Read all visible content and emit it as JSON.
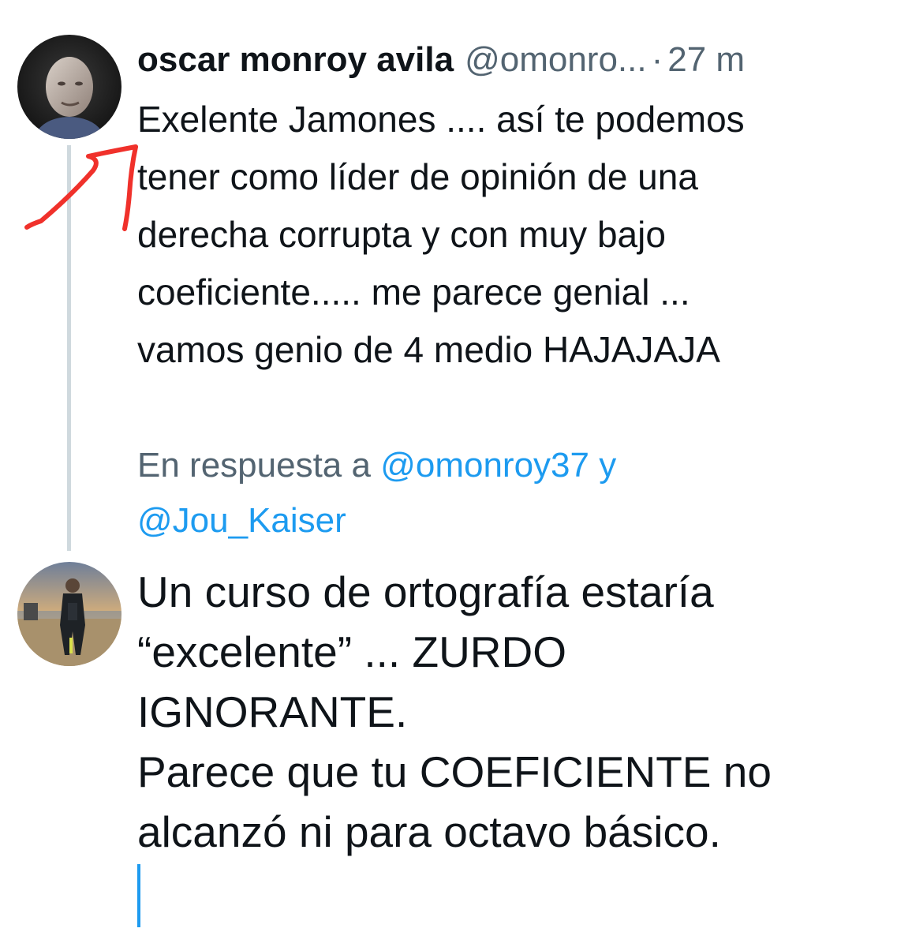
{
  "tweet": {
    "author": {
      "display_name": "oscar monroy avila",
      "handle": "@omonro...",
      "avatar_icon": "person-photo-avatar"
    },
    "separator": "·",
    "time": "27 m",
    "text_lines": [
      "Exelente Jamones .... así te podemos",
      "tener como líder de opinión de una",
      "derecha corrupta y con muy bajo",
      "coeficiente..... me parece genial ...",
      "vamos genio de 4 medio HAJAJAJA"
    ]
  },
  "reply_context": {
    "prefix": "En respuesta a ",
    "mention_1": "@omonroy37",
    "conjunction": " y",
    "mention_2": "@Jou_Kaiser"
  },
  "reply": {
    "avatar_icon": "beach-photo-avatar",
    "text_lines": [
      "Un curso de ortografía estaría",
      "“excelente” ... ZURDO",
      "IGNORANTE.",
      "Parece que tu COEFICIENTE no",
      "alcanzó ni para octavo básico."
    ]
  },
  "colors": {
    "text": "#0f1419",
    "muted": "#536471",
    "link": "#1d9bf0",
    "thread_line": "#cfd9de",
    "annotation": "#f0312b"
  }
}
